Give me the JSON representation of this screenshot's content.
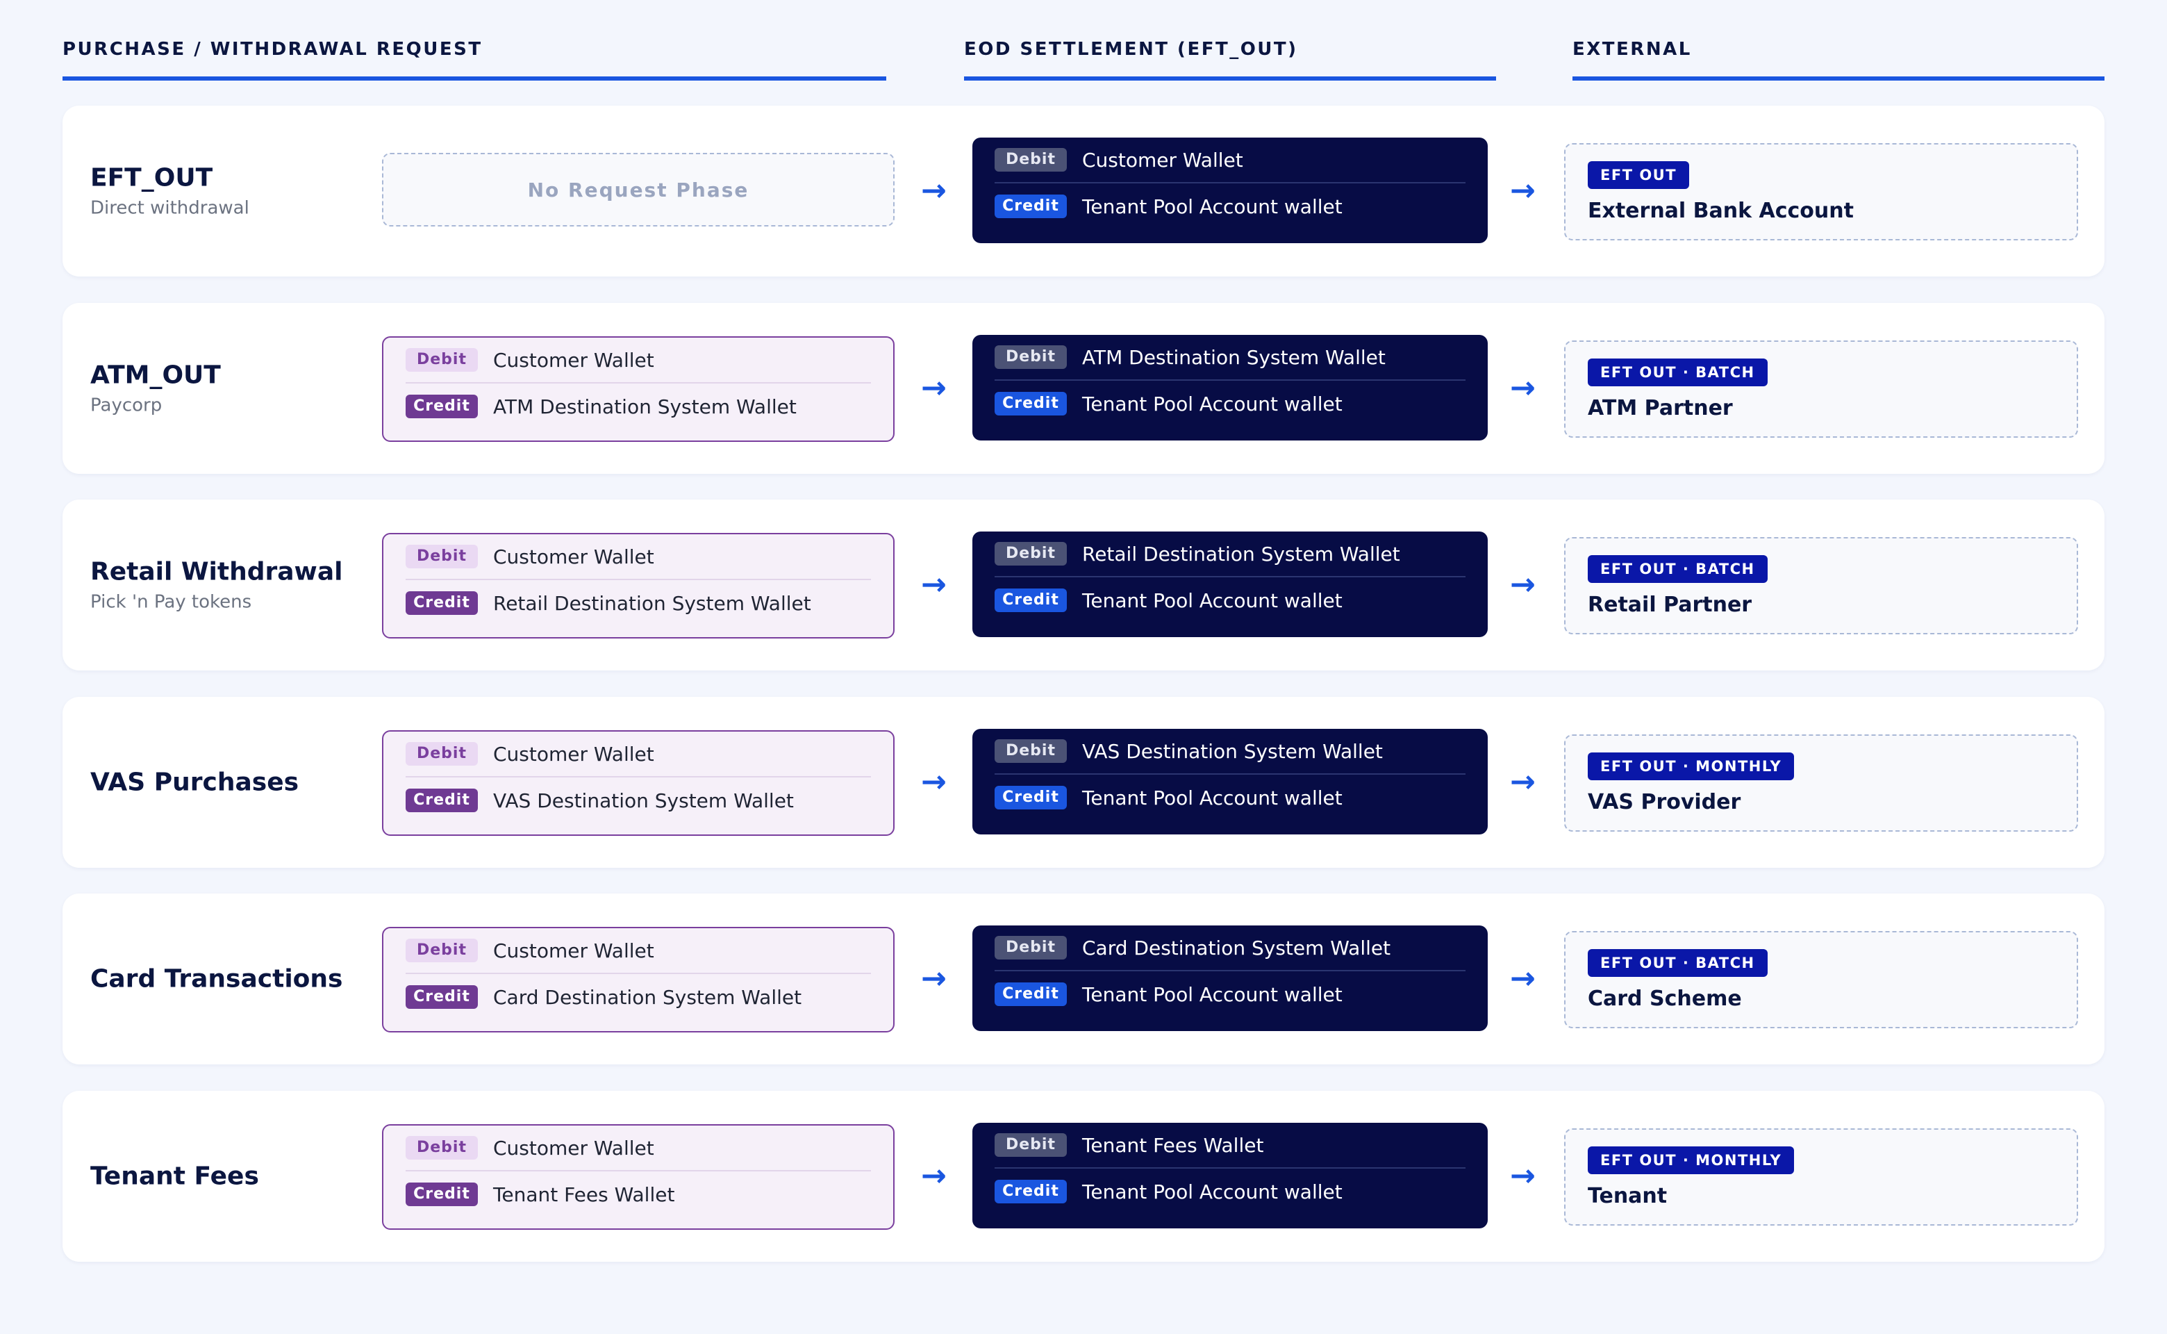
{
  "headers": {
    "request": "PURCHASE / WITHDRAWAL REQUEST",
    "eod": "EOD SETTLEMENT (EFT_OUT)",
    "external": "EXTERNAL"
  },
  "labels": {
    "debit": "Debit",
    "credit": "Credit",
    "no_request": "No Request Phase",
    "arrow": "→"
  },
  "colors": {
    "accent": "#1a56e0",
    "navy": "#070c45",
    "purple": "#7a3f9e",
    "badge": "#0a17a8"
  },
  "rows": [
    {
      "name": "EFT_OUT",
      "sub": "Direct withdrawal",
      "request": null,
      "eod": {
        "debit": "Customer Wallet",
        "credit": "Tenant Pool Account wallet"
      },
      "external": {
        "badge": "EFT OUT",
        "name": "External Bank Account"
      }
    },
    {
      "name": "ATM_OUT",
      "sub": "Paycorp",
      "request": {
        "debit": "Customer Wallet",
        "credit": "ATM Destination System Wallet"
      },
      "eod": {
        "debit": "ATM Destination System Wallet",
        "credit": "Tenant Pool Account wallet"
      },
      "external": {
        "badge": "EFT OUT · BATCH",
        "name": "ATM Partner"
      }
    },
    {
      "name": "Retail Withdrawal",
      "sub": "Pick 'n Pay tokens",
      "request": {
        "debit": "Customer Wallet",
        "credit": "Retail Destination System Wallet"
      },
      "eod": {
        "debit": "Retail Destination System Wallet",
        "credit": "Tenant Pool Account wallet"
      },
      "external": {
        "badge": "EFT OUT · BATCH",
        "name": "Retail Partner"
      }
    },
    {
      "name": "VAS Purchases",
      "sub": "",
      "request": {
        "debit": "Customer Wallet",
        "credit": "VAS Destination System Wallet"
      },
      "eod": {
        "debit": "VAS Destination System Wallet",
        "credit": "Tenant Pool Account wallet"
      },
      "external": {
        "badge": "EFT OUT · MONTHLY",
        "name": "VAS Provider"
      }
    },
    {
      "name": "Card Transactions",
      "sub": "",
      "request": {
        "debit": "Customer Wallet",
        "credit": "Card Destination System Wallet"
      },
      "eod": {
        "debit": "Card Destination System Wallet",
        "credit": "Tenant Pool Account wallet"
      },
      "external": {
        "badge": "EFT OUT · BATCH",
        "name": "Card Scheme"
      }
    },
    {
      "name": "Tenant Fees",
      "sub": "",
      "request": {
        "debit": "Customer Wallet",
        "credit": "Tenant Fees Wallet"
      },
      "eod": {
        "debit": "Tenant Fees Wallet",
        "credit": "Tenant Pool Account wallet"
      },
      "external": {
        "badge": "EFT OUT · MONTHLY",
        "name": "Tenant"
      }
    }
  ]
}
